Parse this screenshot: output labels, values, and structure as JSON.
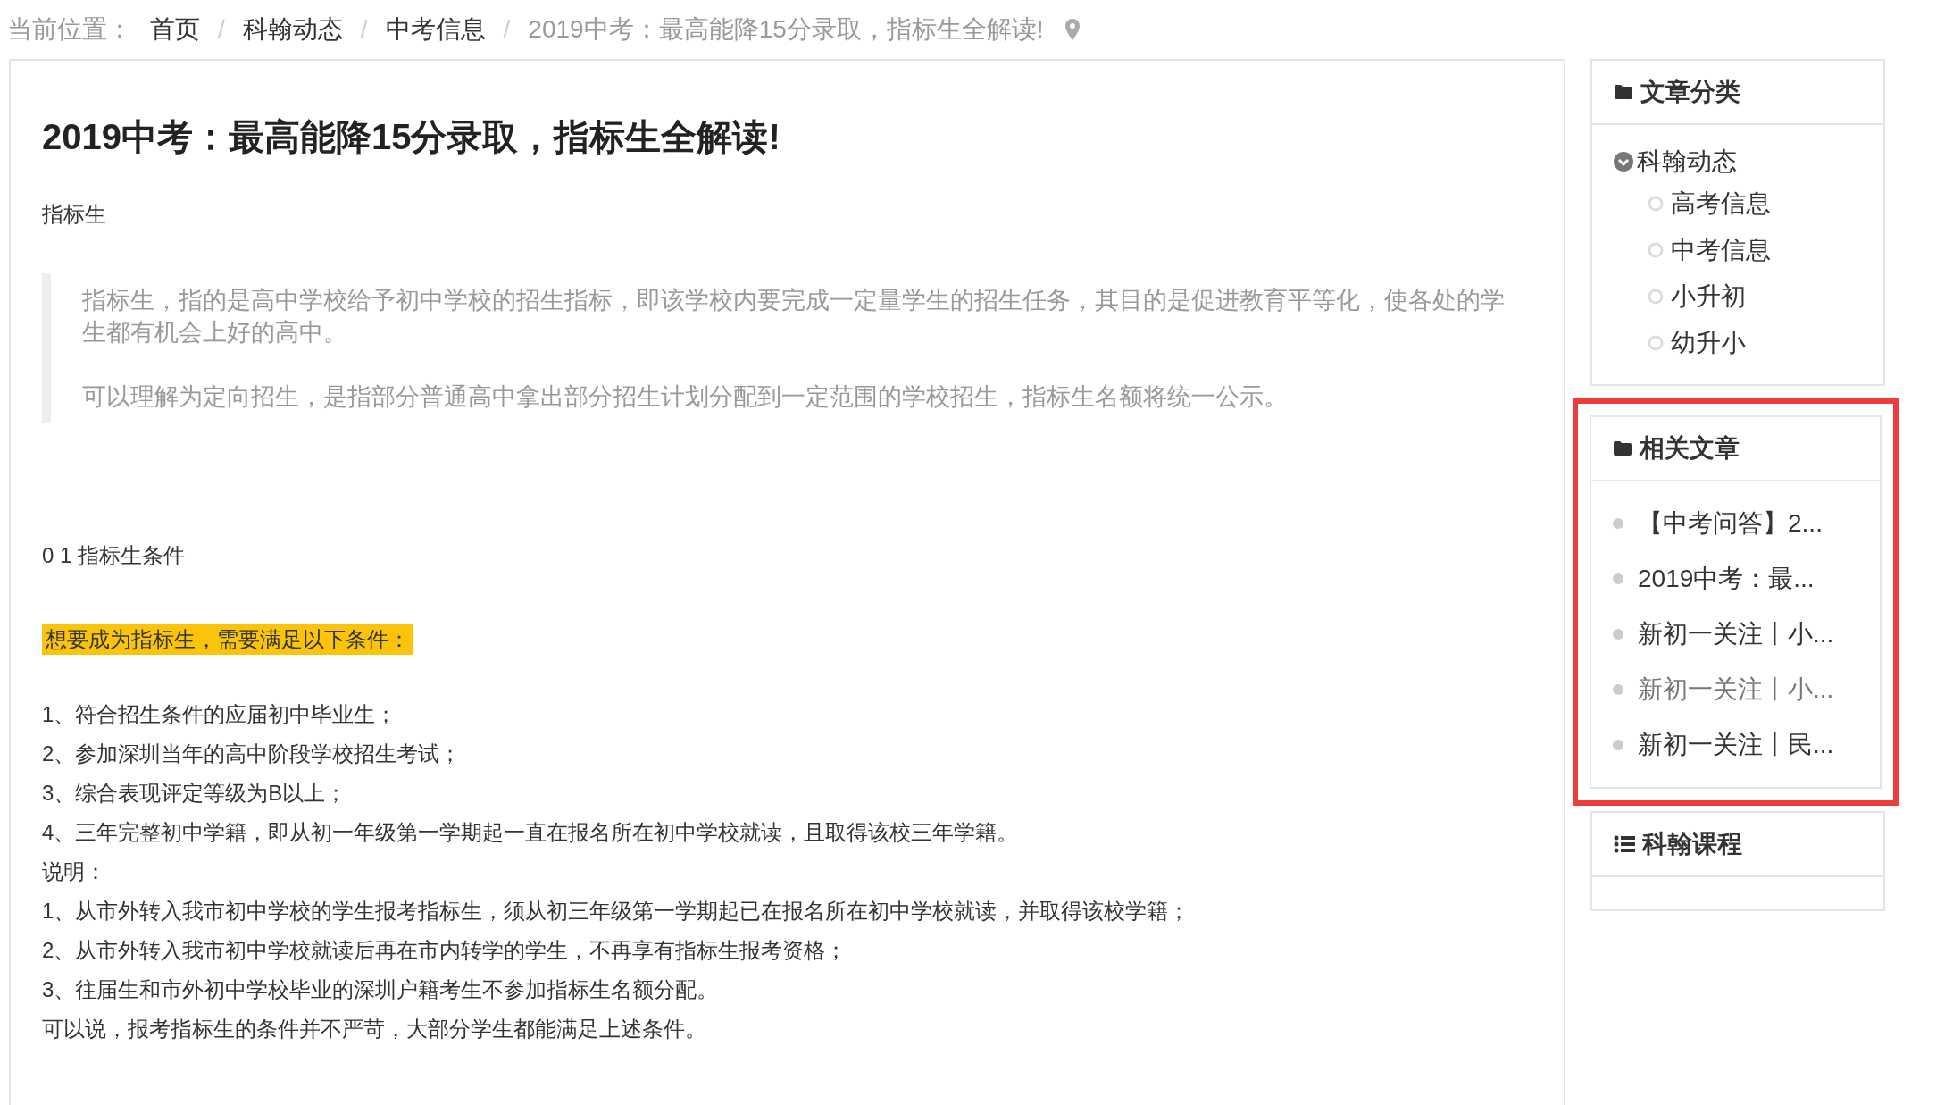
{
  "breadcrumb": {
    "label": "当前位置：",
    "separator": "/",
    "items": [
      {
        "text": "首页",
        "kind": "link"
      },
      {
        "text": "科翰动态",
        "kind": "link"
      },
      {
        "text": "中考信息",
        "kind": "link"
      },
      {
        "text": "2019中考：最高能降15分录取，指标生全解读!",
        "kind": "current"
      }
    ]
  },
  "article": {
    "title": "2019中考：最高能降15分录取，指标生全解读!",
    "tag": "指标生",
    "quote": [
      "指标生，指的是高中学校给予初中学校的招生指标，即该学校内要完成一定量学生的招生任务，其目的是促进教育平等化，使各处的学生都有机会上好的高中。",
      "可以理解为定向招生，是指部分普通高中拿出部分招生计划分配到一定范围的学校招生，指标生名额将统一公示。"
    ],
    "section": "0 1 指标生条件",
    "highlight": "想要成为指标生，需要满足以下条件：",
    "lines": [
      "1、符合招生条件的应届初中毕业生；",
      "2、参加深圳当年的高中阶段学校招生考试；",
      "3、综合表现评定等级为B以上；",
      "4、三年完整初中学籍，即从初一年级第一学期起一直在报名所在初中学校就读，且取得该校三年学籍。",
      "说明：",
      "1、从市外转入我市初中学校的学生报考指标生，须从初三年级第一学期起已在报名所在初中学校就读，并取得该校学籍；",
      "2、从市外转入我市初中学校就读后再在市内转学的学生，不再享有指标生报考资格；",
      "3、往届生和市外初中学校毕业的深圳户籍考生不参加指标生名额分配。",
      "可以说，报考指标生的条件并不严苛，大部分学生都能满足上述条件。"
    ]
  },
  "sidebar": {
    "categories": {
      "title": "文章分类",
      "items": [
        {
          "text": "科翰动态",
          "expanded": true,
          "children": [
            {
              "text": "高考信息"
            },
            {
              "text": "中考信息"
            },
            {
              "text": "小升初"
            },
            {
              "text": "幼升小"
            }
          ]
        }
      ]
    },
    "related": {
      "title": "相关文章",
      "highlighted": true,
      "items": [
        {
          "text": "【中考问答】2...",
          "hovered": false
        },
        {
          "text": "2019中考：最...",
          "hovered": false
        },
        {
          "text": "新初一关注丨小...",
          "hovered": false
        },
        {
          "text": "新初一关注丨小...",
          "hovered": true
        },
        {
          "text": "新初一关注丨民...",
          "hovered": false
        }
      ]
    },
    "courses": {
      "title": "科翰课程"
    }
  }
}
